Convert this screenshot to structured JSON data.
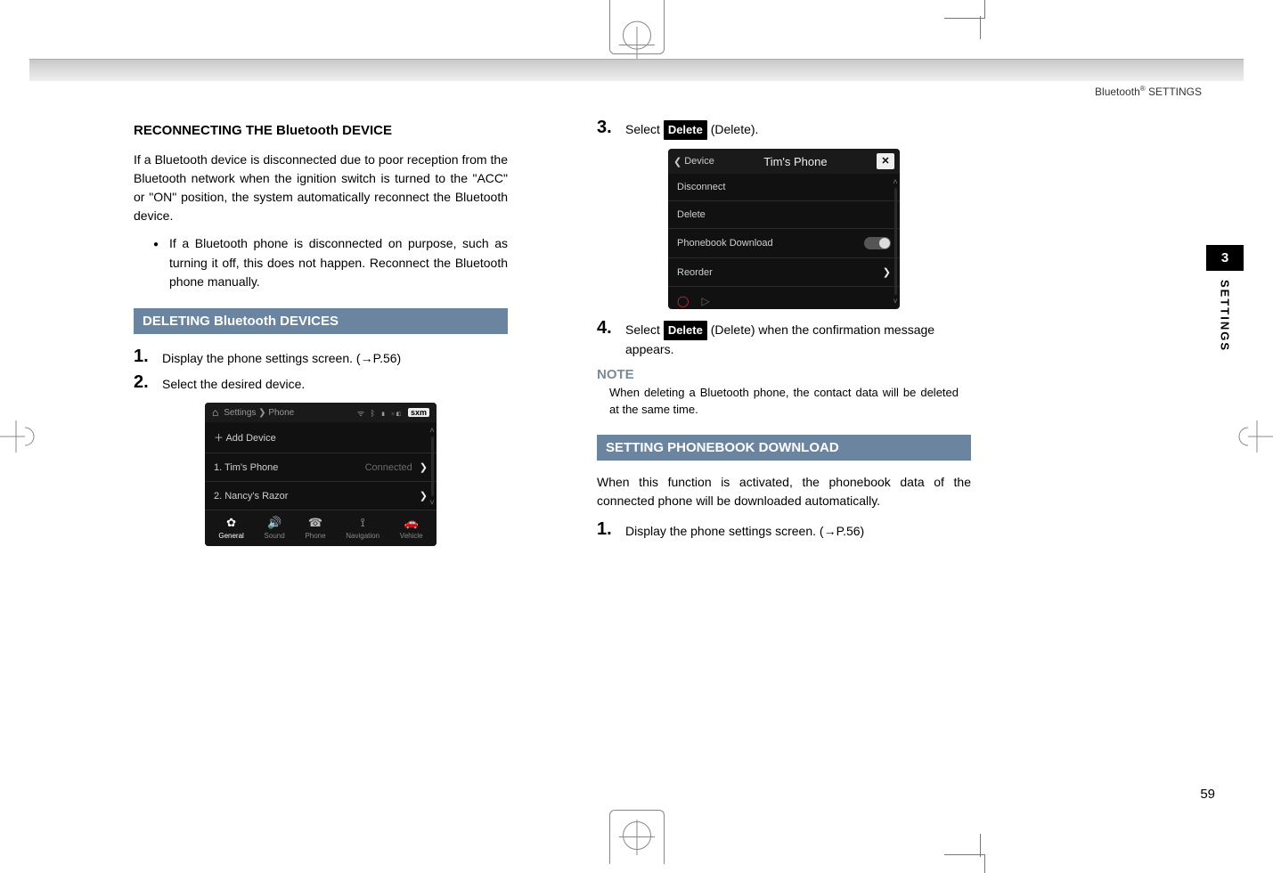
{
  "header": {
    "breadcrumb_a": "Bluetooth",
    "breadcrumb_sup": "®",
    "breadcrumb_b": " SETTINGS"
  },
  "side": {
    "chapter": "3",
    "label": "SETTINGS"
  },
  "left": {
    "h3": "RECONNECTING THE Bluetooth DEVICE",
    "p1": "If a Bluetooth device is disconnected due to poor reception from the Bluetooth network when the ignition switch is turned to the \"ACC\" or \"ON\" position, the system automatically reconnect the Bluetooth device.",
    "bullet": "If a Bluetooth phone is disconnected on purpose, such as turning it off, this does not happen. Reconnect the Bluetooth phone manually.",
    "h2": "DELETING Bluetooth DEVICES",
    "step1": "Display the phone settings screen. (→P.56)",
    "step2": "Select the desired device."
  },
  "ss1": {
    "crumb": "Settings ❯ Phone",
    "status_glyphs": "ᯤ ᛒ ▮ ▫◧",
    "sxm": "sxm",
    "add": "＋ Add Device",
    "row1": "1. Tim's Phone",
    "row1_status": "Connected",
    "row2": "2. Nancy's Razor",
    "footer": {
      "general": "General",
      "sound": "Sound",
      "phone": "Phone",
      "nav": "Navigation",
      "veh": "Vehicle"
    }
  },
  "right": {
    "step3_a": "Select ",
    "step3_btn": "Delete",
    "step3_b": " (Delete).",
    "step4_a": "Select ",
    "step4_btn": "Delete",
    "step4_b": " (Delete) when the confirmation message appears.",
    "note_head": "NOTE",
    "note_body": "When deleting a Bluetooth phone, the contact data will be deleted at the same time.",
    "h2": "SETTING PHONEBOOK DOWNLOAD",
    "p1": "When this function is activated, the phonebook data of the connected phone will be downloaded automatically.",
    "step1": "Display the phone settings screen. (→P.56)"
  },
  "ss2": {
    "back": "Device",
    "title": "Tim's Phone",
    "close": "✕",
    "r1": "Disconnect",
    "r2": "Delete",
    "r3": "Phonebook Download",
    "r4": "Reorder"
  },
  "page": "59"
}
